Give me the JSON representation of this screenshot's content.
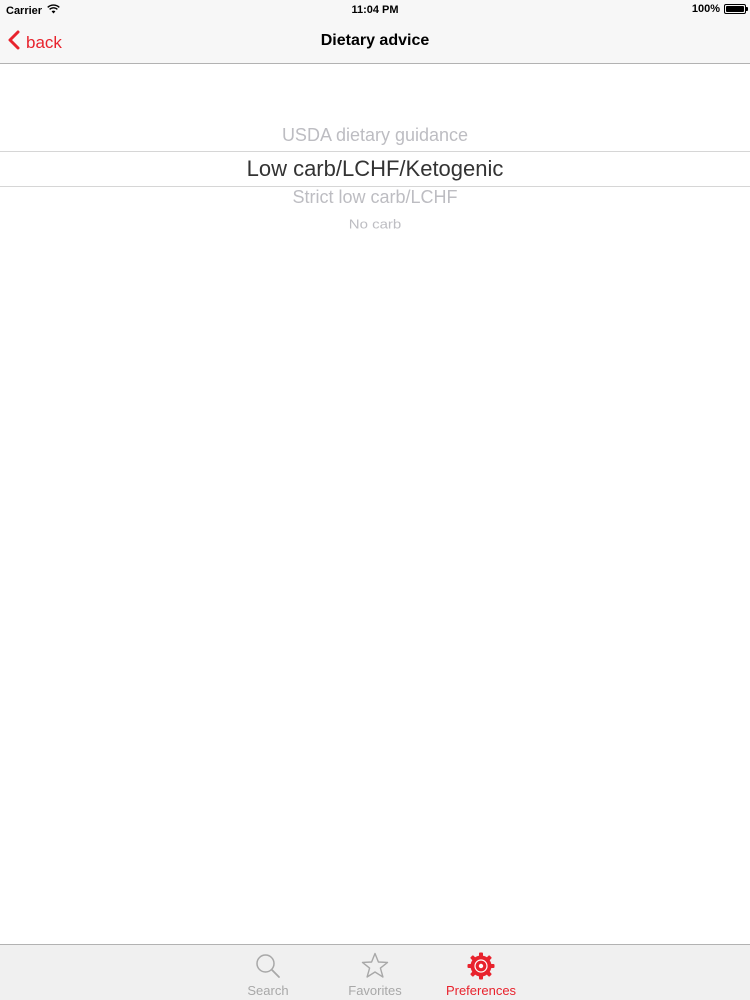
{
  "status_bar": {
    "carrier": "Carrier",
    "time": "11:04 PM",
    "battery": "100%"
  },
  "nav_bar": {
    "back_label": "back",
    "title": "Dietary advice"
  },
  "picker": {
    "options": [
      "USDA dietary guidance",
      "Low carb/LCHF/Ketogenic",
      "Strict low carb/LCHF",
      "No carb"
    ],
    "selected": "Low carb/LCHF/Ketogenic"
  },
  "tab_bar": {
    "tabs": [
      {
        "label": "Search",
        "icon": "search-icon",
        "active": false
      },
      {
        "label": "Favorites",
        "icon": "star-icon",
        "active": false
      },
      {
        "label": "Preferences",
        "icon": "gear-icon",
        "active": true
      }
    ]
  },
  "colors": {
    "accent": "#e8232d",
    "inactive": "#a8a8a8",
    "picker_faded": "#bdbdc2",
    "picker_selected": "#333333"
  }
}
